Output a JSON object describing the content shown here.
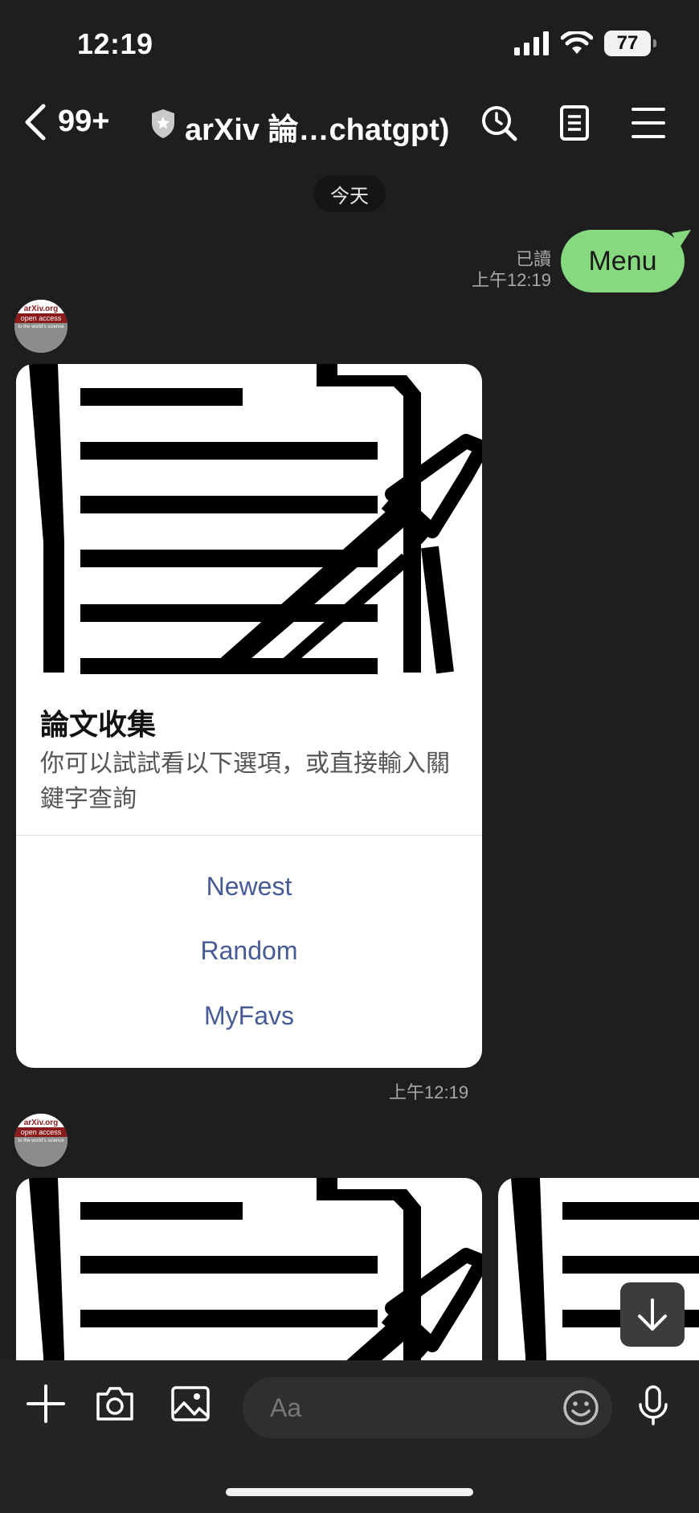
{
  "status_bar": {
    "time": "12:19",
    "battery": "77"
  },
  "header": {
    "unread_count": "99+",
    "chat_title": "arXiv 論…chatgpt)"
  },
  "date_divider": "今天",
  "sent_message": {
    "text": "Menu",
    "read_label": "已讀",
    "time": "上午12:19"
  },
  "avatar": {
    "line1": "arXiv.org",
    "line2": "open access",
    "line3": "to the world's science"
  },
  "card": {
    "title": "論文收集",
    "description": "你可以試試看以下選項，或直接輸入關鍵字查詢",
    "buttons": [
      "Newest",
      "Random",
      "MyFavs"
    ],
    "time": "上午12:19"
  },
  "input_bar": {
    "placeholder": "Aa"
  },
  "icons": {
    "back": "chevron-left-icon",
    "shield": "shield-icon",
    "search": "search-icon",
    "notes": "notes-icon",
    "menu": "menu-icon",
    "plus": "plus-icon",
    "camera": "camera-icon",
    "image": "image-icon",
    "emoji": "emoji-icon",
    "mic": "microphone-icon",
    "scroll_down": "arrow-down-icon"
  },
  "colors": {
    "sent_bubble": "#86d97f",
    "link_button": "#465b96",
    "background": "#1e1e1e"
  }
}
